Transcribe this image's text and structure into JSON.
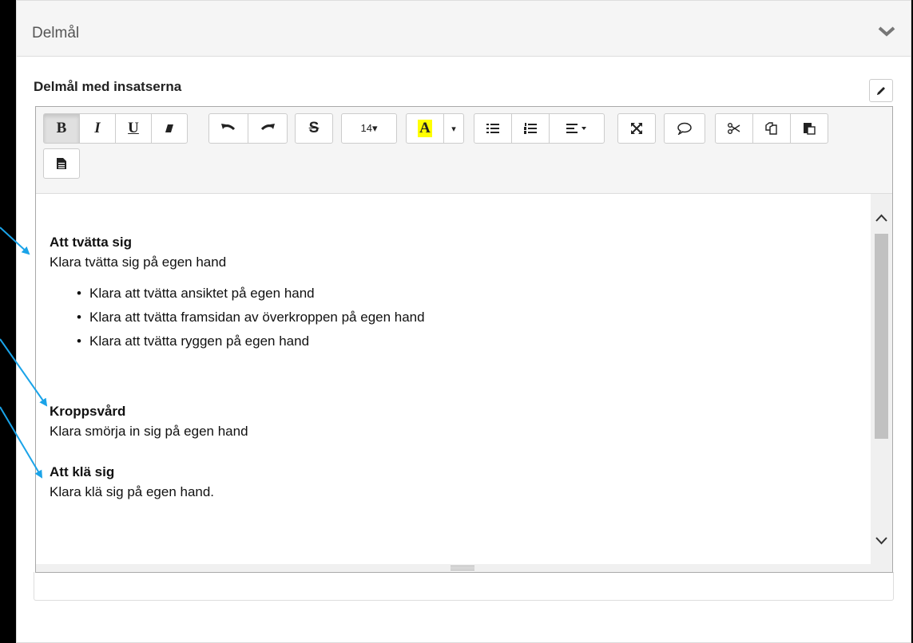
{
  "panel": {
    "title": "Delmål",
    "collapse_icon": "chevron-down-icon"
  },
  "field": {
    "label": "Delmål med insatserna",
    "edit_icon": "pencil-icon"
  },
  "toolbar": {
    "bold": "B",
    "italic": "I",
    "underline": "U",
    "clear_format_icon": "eraser-icon",
    "undo_icon": "undo-icon",
    "redo_icon": "redo-icon",
    "strikethrough": "S",
    "font_size": "14▾",
    "text_color": "A",
    "text_color_dropdown": "▾",
    "ul_icon": "unordered-list-icon",
    "ol_icon": "ordered-list-icon",
    "align_icon": "align-icon",
    "fullscreen_icon": "fullscreen-icon",
    "comment_icon": "comment-icon",
    "cut_icon": "scissors-icon",
    "copy_icon": "copy-icon",
    "paste_icon": "paste-icon",
    "document_icon": "document-icon",
    "accent_color": "#ffff00"
  },
  "content": {
    "sections": [
      {
        "title": "Att tvätta sig",
        "text": "Klara tvätta sig på egen hand",
        "bullets": [
          "Klara att tvätta ansiktet på egen hand",
          "Klara att tvätta framsidan av överkroppen på egen hand",
          "Klara att tvätta ryggen på egen hand"
        ]
      },
      {
        "title": "Kroppsvård",
        "text": "Klara smörja in sig på egen hand"
      },
      {
        "title": "Att klä sig",
        "text": "Klara klä sig på egen hand."
      }
    ]
  },
  "annotation_color": "#1aa3e8"
}
